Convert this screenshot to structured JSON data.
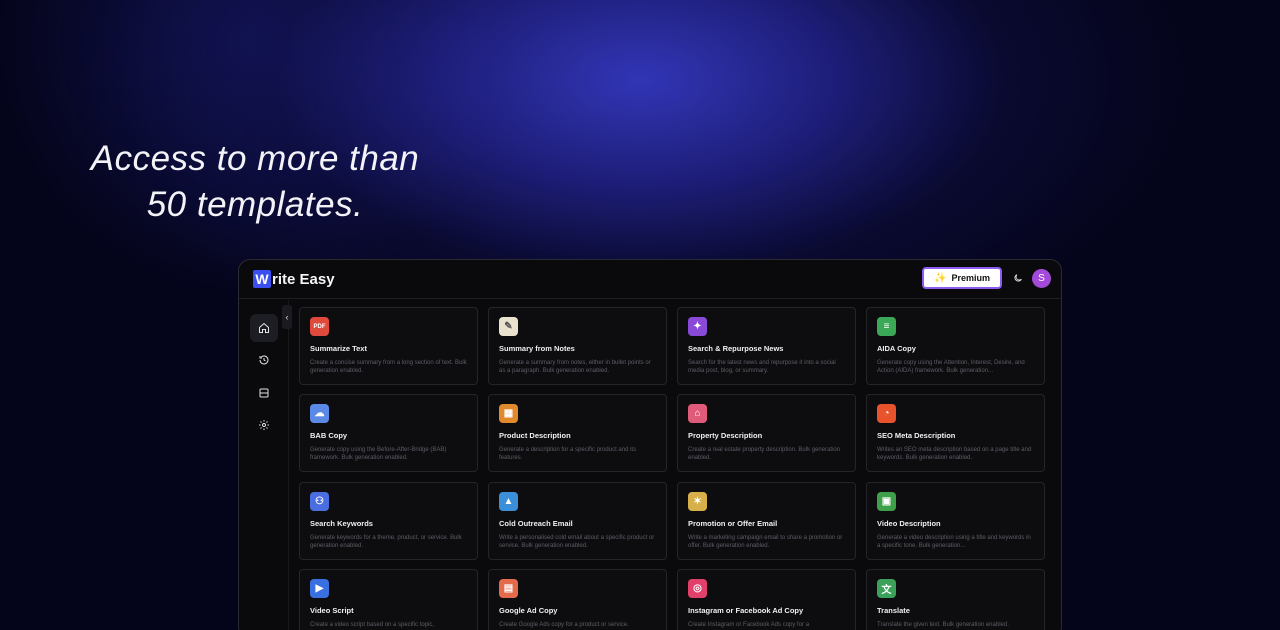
{
  "headline": "Access to more than 50 templates.",
  "app": {
    "logo_letter": "W",
    "logo_rest": "rite Easy",
    "premium_label": "Premium",
    "avatar_initial": "S"
  },
  "colors": {
    "accent": "#3b4ef0",
    "premium_border": "#8c5cf0",
    "avatar": "#a34ad8"
  },
  "sidebar": {
    "items": [
      {
        "name": "home",
        "icon": "home-icon",
        "active": true
      },
      {
        "name": "history",
        "icon": "history-icon",
        "active": false
      },
      {
        "name": "saved",
        "icon": "archive-icon",
        "active": false
      },
      {
        "name": "settings",
        "icon": "gear-icon",
        "active": false
      }
    ]
  },
  "templates": [
    {
      "title": "Summarize Text",
      "desc": "Create a concise summary from a long section of text. Bulk generation enabled.",
      "icon": "pdf-icon",
      "color": "#e04a3c",
      "glyph": "PDF"
    },
    {
      "title": "Summary from Notes",
      "desc": "Generate a summary from notes, either in bullet points or as a paragraph. Bulk generation enabled.",
      "icon": "notepad-icon",
      "color": "#e9e2cf",
      "glyph": "✎"
    },
    {
      "title": "Search & Repurpose News",
      "desc": "Search for the latest news and repurpose it into a social media post, blog, or summary.",
      "icon": "news-icon",
      "color": "#8a4ad8",
      "glyph": "✦"
    },
    {
      "title": "AIDA Copy",
      "desc": "Generate copy using the Attention, Interest, Desire, and Action (AIDA) framework. Bulk generation...",
      "icon": "layers-icon",
      "color": "#3aa856",
      "glyph": "≡"
    },
    {
      "title": "BAB Copy",
      "desc": "Generate copy using the Before-After-Bridge (BAB) framework. Bulk generation enabled.",
      "icon": "cloud-icon",
      "color": "#5b8ae6",
      "glyph": "☁"
    },
    {
      "title": "Product Description",
      "desc": "Generate a description for a specific product and its features.",
      "icon": "boxes-icon",
      "color": "#e08a2c",
      "glyph": "▦"
    },
    {
      "title": "Property Description",
      "desc": "Create a real estate property description. Bulk generation enabled.",
      "icon": "property-icon",
      "color": "#e05a7a",
      "glyph": "⌂"
    },
    {
      "title": "SEO Meta Description",
      "desc": "Writes an SEO meta description based on a page title and keywords. Bulk generation enabled.",
      "icon": "seo-icon",
      "color": "#e8532c",
      "glyph": "◔"
    },
    {
      "title": "Search Keywords",
      "desc": "Generate keywords for a theme, product, or service. Bulk generation enabled.",
      "icon": "people-icon",
      "color": "#4a6ee0",
      "glyph": "⚇"
    },
    {
      "title": "Cold Outreach Email",
      "desc": "Write a personalised cold email about a specific product or service. Bulk generation enabled.",
      "icon": "mountain-icon",
      "color": "#3a8fd8",
      "glyph": "▲"
    },
    {
      "title": "Promotion or Offer Email",
      "desc": "Write a marketing campaign email to share a promotion or offer. Bulk generation enabled.",
      "icon": "megaphone-icon",
      "color": "#d8b04a",
      "glyph": "✶"
    },
    {
      "title": "Video Description",
      "desc": "Generate a video description using a title and keywords in a specific tone. Bulk generation...",
      "icon": "video-board-icon",
      "color": "#3fa04a",
      "glyph": "▣"
    },
    {
      "title": "Video Script",
      "desc": "Create a video script based on a specific topic,",
      "icon": "clapper-icon",
      "color": "#3a6fe0",
      "glyph": "▶"
    },
    {
      "title": "Google Ad Copy",
      "desc": "Create Google Ads copy for a product or service.",
      "icon": "document-icon",
      "color": "#e36a4a",
      "glyph": "▤"
    },
    {
      "title": "Instagram or Facebook Ad Copy",
      "desc": "Create Instagram or Facebook Ads copy for a",
      "icon": "instagram-icon",
      "color": "#e0406a",
      "glyph": "◎"
    },
    {
      "title": "Translate",
      "desc": "Translate the given text. Bulk generation enabled.",
      "icon": "translate-icon",
      "color": "#3aa05a",
      "glyph": "文"
    }
  ]
}
